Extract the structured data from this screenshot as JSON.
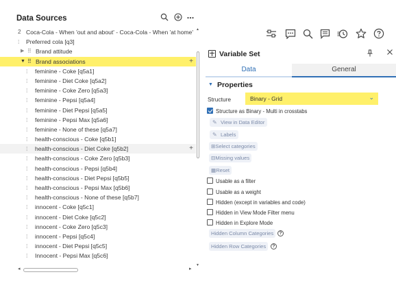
{
  "left_panel": {
    "title": "Data Sources",
    "header_icons": [
      "search-icon",
      "add-circle-icon",
      "more-icon"
    ],
    "rows": [
      {
        "kind": "top",
        "num": "2",
        "label": "Coca-Cola - When 'out and about' - Coca-Cola - When 'at home'"
      },
      {
        "kind": "top",
        "num": "",
        "label": "Preferred cola [q3]"
      },
      {
        "kind": "group",
        "label": "Brand attitude",
        "expanded": false
      },
      {
        "kind": "group",
        "label": "Brand associations",
        "expanded": true,
        "selected": true,
        "plus": "+"
      },
      {
        "kind": "var",
        "label": "feminine - Coke [q5a1]"
      },
      {
        "kind": "var",
        "label": "feminine - Diet Coke [q5a2]"
      },
      {
        "kind": "var",
        "label": "feminine - Coke Zero [q5a3]"
      },
      {
        "kind": "var",
        "label": "feminine - Pepsi [q5a4]"
      },
      {
        "kind": "var",
        "label": "feminine - Diet Pepsi [q5a5]"
      },
      {
        "kind": "var",
        "label": "feminine - Pepsi Max [q5a6]"
      },
      {
        "kind": "var",
        "label": "feminine - None of these [q5a7]"
      },
      {
        "kind": "var",
        "label": "health-conscious - Coke [q5b1]"
      },
      {
        "kind": "var",
        "label": "health-conscious - Diet Coke [q5b2]",
        "hover": true,
        "plus": "+"
      },
      {
        "kind": "var",
        "label": "health-conscious - Coke Zero [q5b3]"
      },
      {
        "kind": "var",
        "label": "health-conscious - Pepsi [q5b4]"
      },
      {
        "kind": "var",
        "label": "health-conscious - Diet Pepsi [q5b5]"
      },
      {
        "kind": "var",
        "label": "health-conscious - Pepsi Max [q5b6]"
      },
      {
        "kind": "var",
        "label": "health-conscious - None of these [q5b7]"
      },
      {
        "kind": "var",
        "label": "innocent - Coke [q5c1]"
      },
      {
        "kind": "var",
        "label": "innocent - Diet Coke [q5c2]"
      },
      {
        "kind": "var",
        "label": "innocent - Coke Zero [q5c3]"
      },
      {
        "kind": "var",
        "label": "innocent - Pepsi [q5c4]"
      },
      {
        "kind": "var",
        "label": "innocent - Diet Pepsi [q5c5]"
      },
      {
        "kind": "var",
        "label": "Innocent - Pepsi Max [q5c6]"
      }
    ]
  },
  "toolbar": {
    "icons": [
      "sliders-icon",
      "comment-icon",
      "search-icon",
      "notes-icon",
      "history-icon",
      "star-icon",
      "help-icon"
    ]
  },
  "variable_set": {
    "title": "Variable Set",
    "tabs": {
      "data": "Data",
      "general": "General"
    },
    "section": "Properties",
    "structure_label": "Structure",
    "structure_value": "Binary - Grid",
    "structure_check": "Structure as Binary - Multi in crosstabs",
    "actions": {
      "view_in_data_editor": "View in Data Editor",
      "labels": "Labels",
      "select_categories": "Select categories",
      "missing_values": "Missing values",
      "reset": "Reset"
    },
    "checkboxes": {
      "usable_filter": "Usable as a filter",
      "usable_weight": "Usable as a weight",
      "hidden_except": "Hidden (except in variables and code)",
      "hidden_view_mode": "Hidden in View Mode Filter menu",
      "hidden_explore": "Hidden in Explore Mode"
    },
    "hidden_column_categories": "Hidden Column Categories",
    "hidden_row_categories": "Hidden Row Categories"
  },
  "colors": {
    "highlight": "#fff06a",
    "accent": "#2f6fb5"
  }
}
